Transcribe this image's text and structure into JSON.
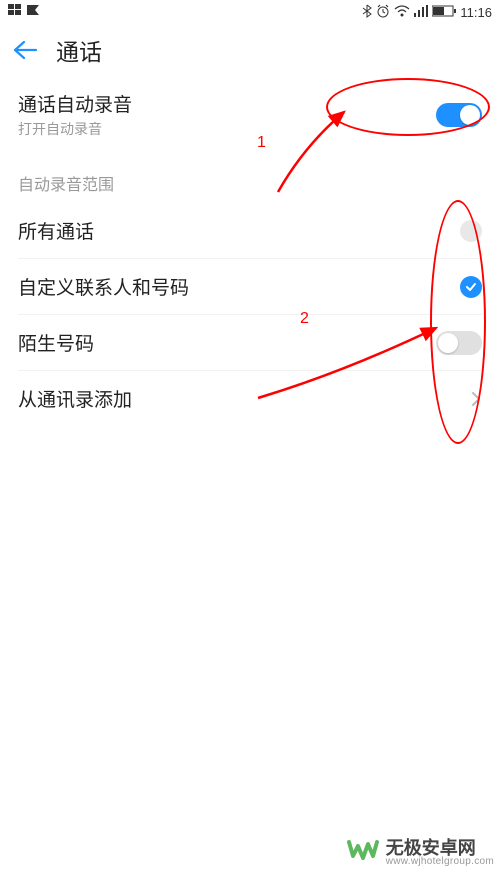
{
  "status_bar": {
    "time": "11:16"
  },
  "header": {
    "title": "通话"
  },
  "auto_record": {
    "title": "通话自动录音",
    "subtitle": "打开自动录音",
    "enabled": true
  },
  "scope_section": {
    "header": "自动录音范围",
    "all_calls": {
      "label": "所有通话",
      "selected": false
    },
    "custom": {
      "label": "自定义联系人和号码",
      "selected": true
    },
    "unknown": {
      "label": "陌生号码",
      "enabled": false
    },
    "add_from_contacts": {
      "label": "从通讯录添加"
    }
  },
  "annotations": {
    "label1": "1",
    "label2": "2"
  },
  "watermark": {
    "name": "无极安卓网",
    "url": "www.wjhotelgroup.com"
  }
}
